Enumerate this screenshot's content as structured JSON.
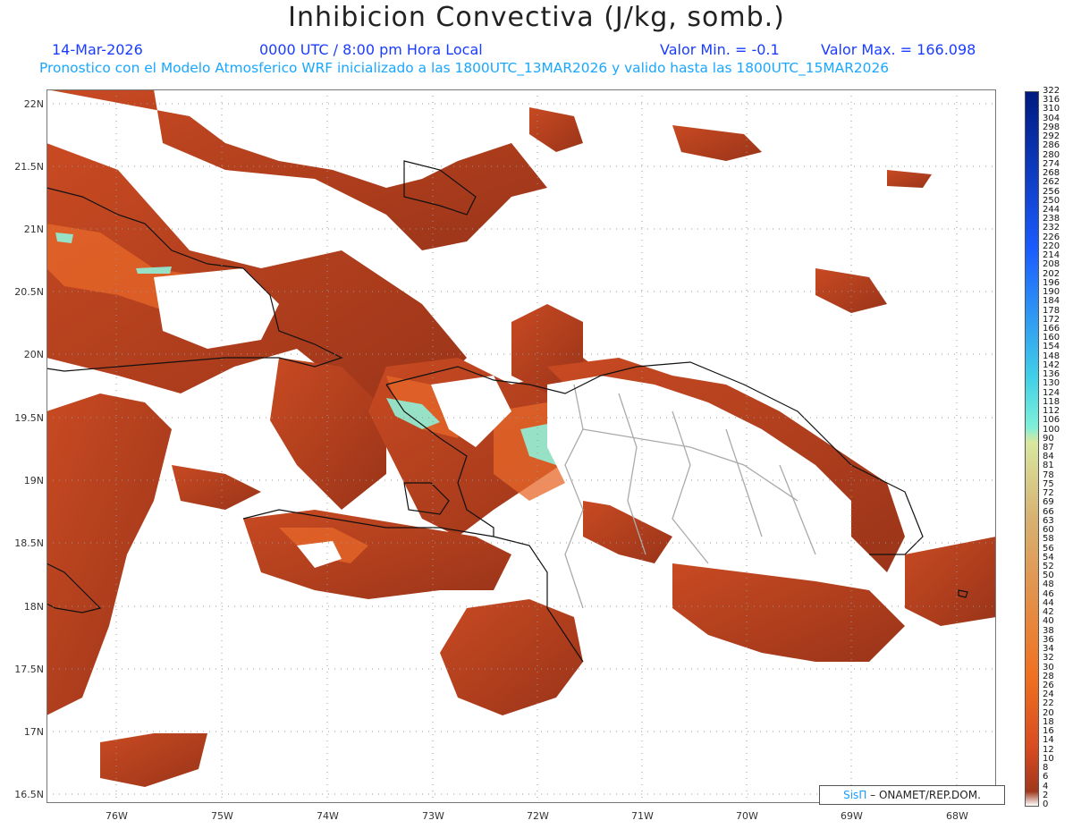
{
  "header": {
    "title": "Inhibicion Convectiva (J/kg, somb.)",
    "date": "14-Mar-2026",
    "time": "0000 UTC / 8:00 pm Hora Local",
    "vmin": "Valor Min. = -0.1",
    "vmax": "Valor Max. = 166.098",
    "forecast": "Pronostico con el Modelo Atmosferico WRF inicializado a las 1800UTC_13MAR2026 y valido hasta las  1800UTC_15MAR2026"
  },
  "axes": {
    "lat_labels": [
      "22N",
      "21.5N",
      "21N",
      "20.5N",
      "20N",
      "19.5N",
      "19N",
      "18.5N",
      "18N",
      "17.5N",
      "17N",
      "16.5N"
    ],
    "lon_labels": [
      "76W",
      "75W",
      "74W",
      "73W",
      "72W",
      "71W",
      "70W",
      "69W",
      "68W"
    ]
  },
  "colorbar": {
    "labels": [
      "322",
      "316",
      "310",
      "304",
      "298",
      "292",
      "286",
      "280",
      "274",
      "268",
      "262",
      "256",
      "250",
      "244",
      "238",
      "232",
      "226",
      "220",
      "214",
      "208",
      "202",
      "196",
      "190",
      "184",
      "178",
      "172",
      "166",
      "160",
      "154",
      "148",
      "142",
      "136",
      "130",
      "124",
      "118",
      "112",
      "106",
      "100",
      "90",
      "87",
      "84",
      "81",
      "78",
      "75",
      "72",
      "69",
      "66",
      "63",
      "60",
      "58",
      "56",
      "54",
      "52",
      "50",
      "48",
      "46",
      "44",
      "42",
      "40",
      "38",
      "36",
      "34",
      "32",
      "30",
      "28",
      "26",
      "24",
      "22",
      "20",
      "18",
      "16",
      "14",
      "12",
      "10",
      "8",
      "6",
      "4",
      "2",
      "0"
    ],
    "colors": {
      "deep_blue": "#001a80",
      "blue": "#1a5cff",
      "cyan": "#40d0e8",
      "aqua": "#80f0d8",
      "pale": "#d8e8a0",
      "tan": "#d8b070",
      "orange": "#f07020",
      "red_orange": "#d84a20",
      "brown": "#a0381c",
      "zero": "#ffffff"
    }
  },
  "map": {
    "field_color": "#a33a1e",
    "field_light": "#e8682a",
    "highlight": "#8ff0d8",
    "coast_color": "#111111",
    "border_color": "#aaaaaa",
    "grid_color": "#999999"
  },
  "credit": {
    "brand": "SisΠ",
    "org": "– ONAMET/REP.DOM."
  }
}
